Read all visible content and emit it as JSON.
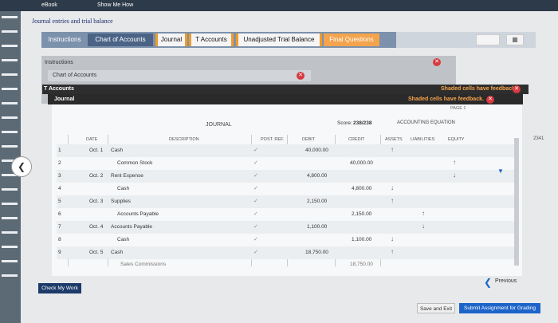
{
  "app": {
    "ebook_label": "eBook",
    "show_me_how_label": "Show Me How"
  },
  "page_title": "Journal entries and trial balance",
  "tabs": [
    {
      "label": "Instructions"
    },
    {
      "label": "Chart of Accounts"
    },
    {
      "label": "Journal"
    },
    {
      "label": "T Accounts"
    },
    {
      "label": "Unadjusted Trial Balance"
    },
    {
      "label": "Final Questions"
    }
  ],
  "panels": {
    "instructions_label": "Instructions",
    "chart_label": "Chart of Accounts",
    "taccounts_label": "T Accounts",
    "journal_label": "Journal",
    "feedback_1": "Shaded cells have feedback.",
    "feedback_2": "Shaded cells have feedback.",
    "page_label": "PAGE 1"
  },
  "journal": {
    "title": "JOURNAL",
    "score_label": "Score:",
    "score_value": "238/238",
    "equation_label": "ACCOUNTING EQUATION",
    "headers": {
      "date": "DATE",
      "description": "DESCRIPTION",
      "post_ref": "POST. REF.",
      "debit": "DEBIT",
      "credit": "CREDIT",
      "assets": "ASSETS",
      "liabilities": "LIABILITIES",
      "equity": "EQUITY"
    },
    "rows": [
      {
        "num": "1",
        "date": "Oct. 1",
        "description": "Cash",
        "debit": "40,000.00",
        "credit": "",
        "assets": "↑",
        "liabilities": "",
        "equity": ""
      },
      {
        "num": "2",
        "date": "",
        "description": "Common Stock",
        "debit": "",
        "credit": "40,000.00",
        "assets": "",
        "liabilities": "",
        "equity": "↑"
      },
      {
        "num": "3",
        "date": "Oct. 2",
        "description": "Rent Expense",
        "debit": "4,800.00",
        "credit": "",
        "assets": "",
        "liabilities": "",
        "equity": "↓"
      },
      {
        "num": "4",
        "date": "",
        "description": "Cash",
        "debit": "",
        "credit": "4,800.00",
        "assets": "↓",
        "liabilities": "",
        "equity": ""
      },
      {
        "num": "5",
        "date": "Oct. 3",
        "description": "Supplies",
        "debit": "2,150.00",
        "credit": "",
        "assets": "↑",
        "liabilities": "",
        "equity": ""
      },
      {
        "num": "6",
        "date": "",
        "description": "Accounts Payable",
        "debit": "",
        "credit": "2,150.00",
        "assets": "",
        "liabilities": "↑",
        "equity": ""
      },
      {
        "num": "7",
        "date": "Oct. 4",
        "description": "Accounts Payable",
        "debit": "1,100.00",
        "credit": "",
        "assets": "",
        "liabilities": "↓",
        "equity": ""
      },
      {
        "num": "8",
        "date": "",
        "description": "Cash",
        "debit": "",
        "credit": "1,100.00",
        "assets": "↓",
        "liabilities": "",
        "equity": ""
      },
      {
        "num": "9",
        "date": "Oct. 5",
        "description": "Cash",
        "debit": "18,750.00",
        "credit": "",
        "assets": "↑",
        "liabilities": "",
        "equity": ""
      }
    ],
    "partial_row_text": "Sales Commissions",
    "partial_credit": "18,750.00"
  },
  "footer": {
    "check_my_work": "Check My Work",
    "previous": "Previous",
    "save_exit": "Save and Exit",
    "submit": "Submit Assignment for Grading"
  },
  "side_badge": "2341"
}
